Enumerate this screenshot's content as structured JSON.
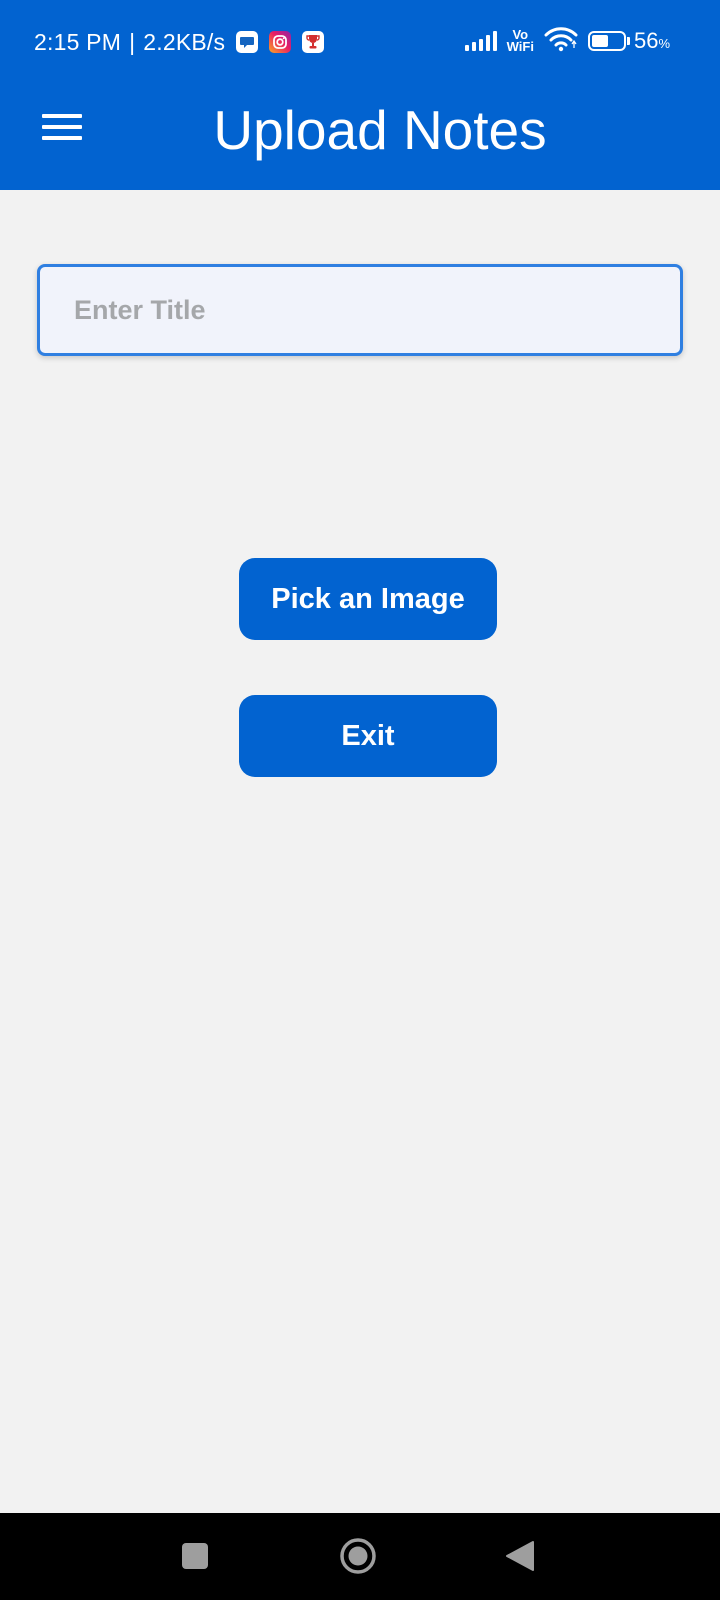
{
  "status_bar": {
    "time": "2:15 PM",
    "separator": "|",
    "network_speed": "2.2KB/s",
    "notification_icons": [
      "chat-icon",
      "instagram-icon",
      "trophy-icon"
    ],
    "vowifi_top": "Vo",
    "vowifi_bottom": "WiFi",
    "battery_percent": "56",
    "battery_unit": "%",
    "battery_level": 0.56
  },
  "app_bar": {
    "menu_icon": "hamburger-menu-icon",
    "title": "Upload Notes"
  },
  "form": {
    "title_input": {
      "placeholder": "Enter Title",
      "value": ""
    },
    "pick_image_label": "Pick an Image",
    "exit_label": "Exit"
  },
  "nav_bar": {
    "icons": [
      "recents-square-icon",
      "home-circle-icon",
      "back-triangle-icon"
    ]
  },
  "colors": {
    "primary": "#0263d0",
    "background": "#f2f2f2",
    "input_border": "#2f7fe1",
    "input_background": "#f1f3fb",
    "placeholder": "#a5a7aa",
    "nav_bar": "#000000"
  }
}
